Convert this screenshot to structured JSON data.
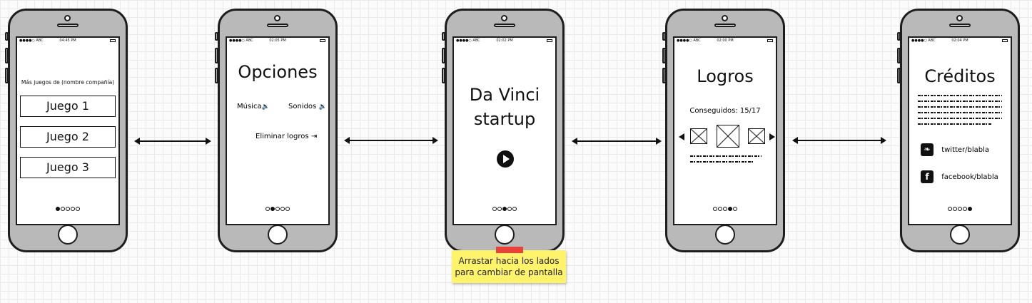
{
  "status_bar": {
    "carrier": "●●●●○ ABC",
    "times": [
      "04:45 PM",
      "02:05 PM",
      "02:02 PM",
      "02:00 PM",
      "02:04 PM"
    ]
  },
  "screen1": {
    "header": "Más juegos de (nombre compañía)",
    "buttons": [
      "Juego 1",
      "Juego 2",
      "Juego 3"
    ]
  },
  "screen2": {
    "title": "Opciones",
    "music_label": "Música",
    "sounds_label": "Sonidos",
    "delete_label": "Eliminar logros"
  },
  "screen3": {
    "title_line1": "Da Vinci",
    "title_line2": "startup"
  },
  "screen4": {
    "title": "Logros",
    "achieved": "Conseguidos: 15/17"
  },
  "screen5": {
    "title": "Créditos",
    "twitter": "twitter/blabla",
    "facebook": "facebook/blabla"
  },
  "sticky_note": {
    "line1": "Arrastar hacia los lados",
    "line2": "para cambiar de pantalla"
  },
  "pagination": {
    "total": 5,
    "active_per_screen": [
      1,
      2,
      3,
      4,
      5
    ]
  },
  "colors": {
    "sticky": "#fff36b",
    "tape": "#e8413a",
    "phone_body": "#b9b9b9"
  },
  "icons": [
    "speaker-icon",
    "logout-icon",
    "play-icon",
    "arrow-left-icon",
    "arrow-right-icon",
    "twitter-icon",
    "facebook-icon"
  ]
}
